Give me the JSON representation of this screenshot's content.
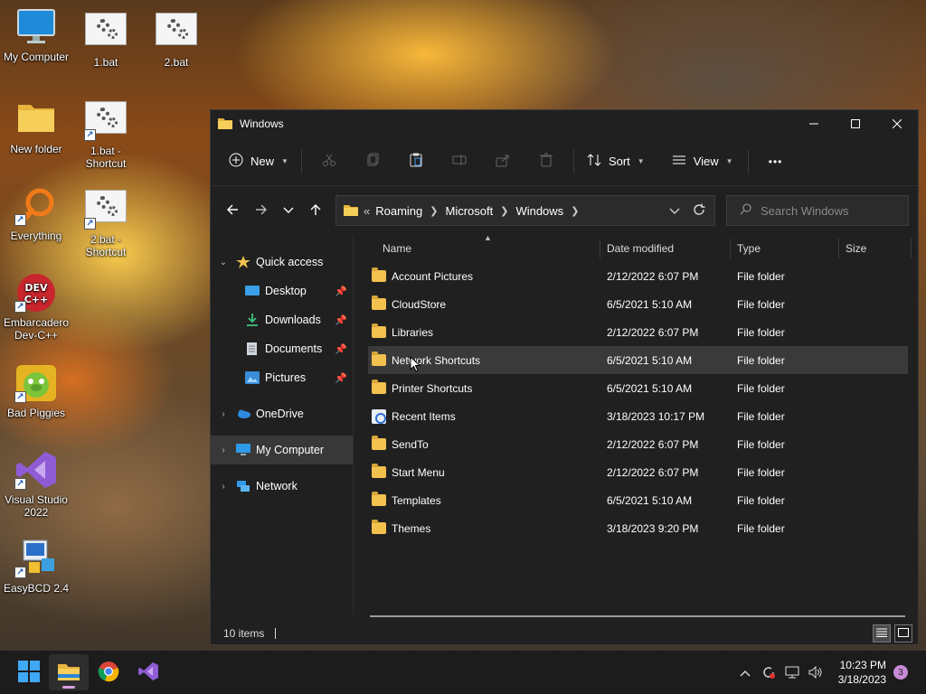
{
  "desktop": {
    "icons": [
      {
        "label": "My Computer",
        "icon": "monitor-icon"
      },
      {
        "label": "1.bat",
        "icon": "batch-file-icon"
      },
      {
        "label": "2.bat",
        "icon": "batch-file-icon"
      },
      {
        "label": "New folder",
        "icon": "folder-icon"
      },
      {
        "label": "1.bat - Shortcut",
        "icon": "batch-file-icon"
      },
      {
        "label": "Everything",
        "icon": "magnifier-icon"
      },
      {
        "label": "2.bat - Shortcut",
        "icon": "batch-file-icon"
      },
      {
        "label": "Embarcadero Dev-C++",
        "icon": "devcpp-icon"
      },
      {
        "label": "Bad Piggies",
        "icon": "bad-piggies-icon"
      },
      {
        "label": "Visual Studio 2022",
        "icon": "visual-studio-icon"
      },
      {
        "label": "EasyBCD 2.4",
        "icon": "easybcd-icon"
      }
    ]
  },
  "window": {
    "title": "Windows",
    "toolbar": {
      "new_label": "New",
      "sort_label": "Sort",
      "view_label": "View",
      "more_label": "•••"
    },
    "address": {
      "overflow": "«",
      "crumbs": [
        "Roaming",
        "Microsoft",
        "Windows"
      ]
    },
    "search": {
      "placeholder": "Search Windows"
    },
    "nav": {
      "quick_access": "Quick access",
      "pinned": [
        "Desktop",
        "Downloads",
        "Documents",
        "Pictures"
      ],
      "onedrive": "OneDrive",
      "my_computer": "My Computer",
      "network": "Network"
    },
    "columns": {
      "name": "Name",
      "date": "Date modified",
      "type": "Type",
      "size": "Size"
    },
    "files": [
      {
        "name": "Account Pictures",
        "date": "2/12/2022 6:07 PM",
        "type": "File folder"
      },
      {
        "name": "CloudStore",
        "date": "6/5/2021 5:10 AM",
        "type": "File folder"
      },
      {
        "name": "Libraries",
        "date": "2/12/2022 6:07 PM",
        "type": "File folder"
      },
      {
        "name": "Network Shortcuts",
        "date": "6/5/2021 5:10 AM",
        "type": "File folder"
      },
      {
        "name": "Printer Shortcuts",
        "date": "6/5/2021 5:10 AM",
        "type": "File folder"
      },
      {
        "name": "Recent Items",
        "date": "3/18/2023 10:17 PM",
        "type": "File folder"
      },
      {
        "name": "SendTo",
        "date": "2/12/2022 6:07 PM",
        "type": "File folder"
      },
      {
        "name": "Start Menu",
        "date": "2/12/2022 6:07 PM",
        "type": "File folder"
      },
      {
        "name": "Templates",
        "date": "6/5/2021 5:10 AM",
        "type": "File folder"
      },
      {
        "name": "Themes",
        "date": "3/18/2023 9:20 PM",
        "type": "File folder"
      }
    ],
    "status": {
      "item_count": "10 items"
    }
  },
  "taskbar": {
    "clock_time": "10:23 PM",
    "clock_date": "3/18/2023",
    "notification_count": "3"
  }
}
